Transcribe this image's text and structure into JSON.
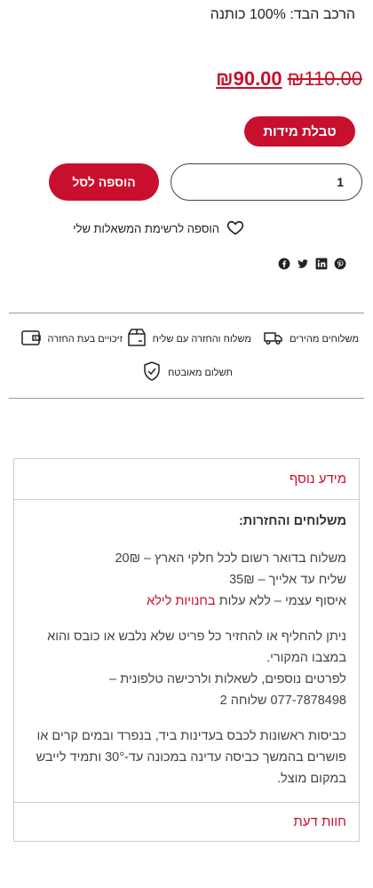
{
  "product": {
    "fabric": "הרכב הבד: 100% כותנה",
    "price_old": "₪110.00",
    "price_new": "₪90.00",
    "size_chart_label": "טבלת מידות",
    "quantity": "1",
    "add_to_cart_label": "הוספה לסל",
    "wishlist_label": "הוספה לרשימת המשאלות שלי"
  },
  "share": {
    "icons": [
      "facebook-icon",
      "twitter-icon",
      "linkedin-icon",
      "pinterest-icon"
    ]
  },
  "features": {
    "fast_shipping": "משלוחים מהירים",
    "shipping_returns": "משלוח והחזרה עם שליח",
    "credit_on_return": "זיכויים בעת החזרה",
    "secure_payment": "תשלום מאובטח"
  },
  "info": {
    "header": "מידע נוסף",
    "shipping_title": "משלוחים והחזרות:",
    "line1": "משלוח בדואר רשום לכל חלקי הארץ – 20₪",
    "line2": "שליח עד אלייך – 35₪",
    "line3_prefix": "איסוף עצמי – ללא עלות ",
    "line3_link": "בחנויות לילא",
    "return_text": "ניתן להחליף או להחזיר כל פריט שלא נלבש או כובס והוא במצבו המקורי.",
    "more_info": "לפרטים נוספים, לשאלות ולרכישה טלפונית –",
    "phone": "077-7878498 שלוחה 2",
    "wash_text": "כביסות ראשונות לכבס בעדינות ביד, בנפרד ובמים קרים או פושרים בהמשך כביסה עדינה במכונה עד-30° ותמיד לייבש במקום מוצל.",
    "review_header": "חוות דעת"
  },
  "colors": {
    "accent": "#c8102e"
  }
}
